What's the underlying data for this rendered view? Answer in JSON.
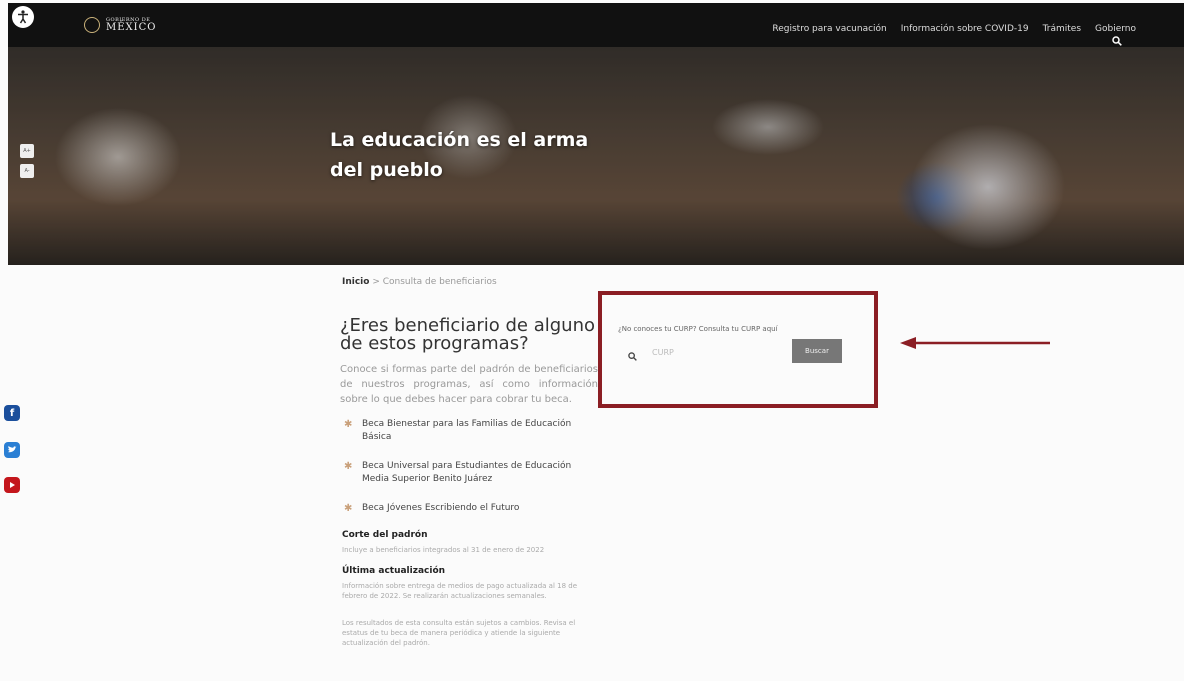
{
  "header": {
    "logo_sub": "GOBIERNO DE",
    "logo_main": "MÉXICO",
    "nav": [
      "Registro para vacunación",
      "Información sobre COVID-19",
      "Trámites",
      "Gobierno"
    ]
  },
  "hero": {
    "title": "La educación es el arma del pueblo"
  },
  "font_controls": [
    "A+",
    "A-"
  ],
  "breadcrumb": {
    "home": "Inicio",
    "separator": ">",
    "current": "Consulta de beneficiarios"
  },
  "main": {
    "title": "¿Eres beneficiario de alguno de estos programas?",
    "intro": "Conoce si formas parte del padrón de beneficiarios de nuestros programas, así como información sobre lo que debes hacer para cobrar tu beca.",
    "programs": [
      "Beca Bienestar para las Familias de Educación Básica",
      "Beca Universal para Estudiantes de Educación Media Superior Benito Juárez",
      "Beca Jóvenes Escribiendo el Futuro"
    ],
    "corte_title": "Corte del padrón",
    "corte_text": "Incluye a beneficiarios integrados al 31 de enero de 2022",
    "update_title": "Última actualización",
    "update_text": "Información sobre entrega de medios de pago actualizada al 18 de febrero de 2022. Se realizarán actualizaciones semanales.",
    "footer_note": "Los resultados de esta consulta están sujetos a cambios. Revisa el estatus de tu beca de manera periódica y atiende la siguiente actualización del padrón."
  },
  "search": {
    "label": "¿No conoces tu CURP? Consulta tu CURP aquí",
    "placeholder": "CURP",
    "button": "Buscar"
  },
  "colors": {
    "highlight_border": "#8b1e24",
    "facebook": "#1b4f9c",
    "twitter": "#2a7fd4",
    "youtube": "#c4161c"
  }
}
